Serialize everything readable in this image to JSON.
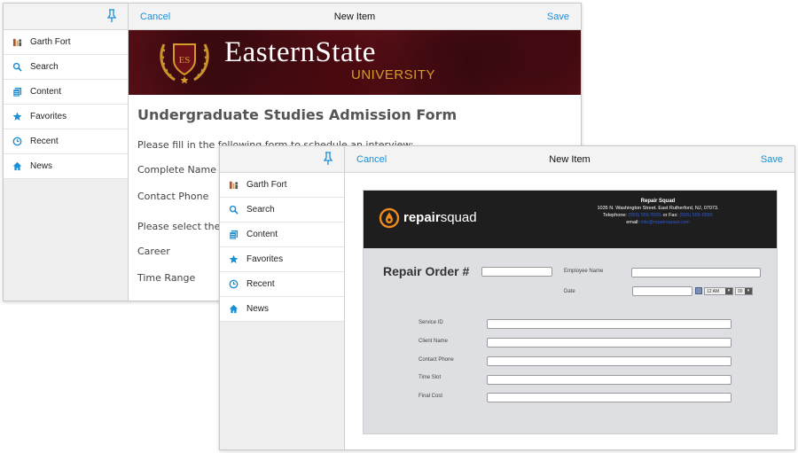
{
  "sidebar_items": [
    {
      "label": "Garth Fort",
      "icon": "user-books-icon"
    },
    {
      "label": "Search",
      "icon": "search-icon"
    },
    {
      "label": "Content",
      "icon": "content-icon"
    },
    {
      "label": "Favorites",
      "icon": "star-icon"
    },
    {
      "label": "Recent",
      "icon": "clock-icon"
    },
    {
      "label": "News",
      "icon": "home-icon"
    }
  ],
  "window1": {
    "cancel": "Cancel",
    "title": "New Item",
    "save": "Save",
    "banner": {
      "name": "EasternState",
      "sub": "UNIVERSITY",
      "crest": "ES"
    },
    "form": {
      "heading": "Undergraduate Studies Admission Form",
      "intro": "Please fill in the following form to schedule an interview:",
      "fields": [
        "Complete Name",
        "Contact Phone"
      ],
      "select_prompt": "Please select the desired career and time range:",
      "fields2": [
        "Career",
        "Time Range"
      ]
    }
  },
  "window2": {
    "cancel": "Cancel",
    "title": "New Item",
    "save": "Save",
    "header": {
      "brand_bold": "repair",
      "brand_rest": "squad",
      "company": "Repair Squad",
      "address": "1035 N. Washington Street. East Rutherford, NJ, 07073.",
      "telephone_label": "Telephone:",
      "telephone": "(555) 555-5555",
      "fax_label": "or Fax:",
      "fax": "(555) 555-5555",
      "email_label": "email:",
      "email": "info@repairsquad.com"
    },
    "form": {
      "title": "Repair Order #",
      "employee_name": "Employee Name",
      "date": "Date",
      "hour": "12 AM",
      "minute": "00",
      "fields": [
        "Service ID",
        "Client Name",
        "Contact Phone",
        "Time Slot",
        "Final Cost"
      ]
    }
  },
  "colors": {
    "accent": "#1a8fd6",
    "banner": "#5b0f17",
    "gold": "#d69a28"
  }
}
